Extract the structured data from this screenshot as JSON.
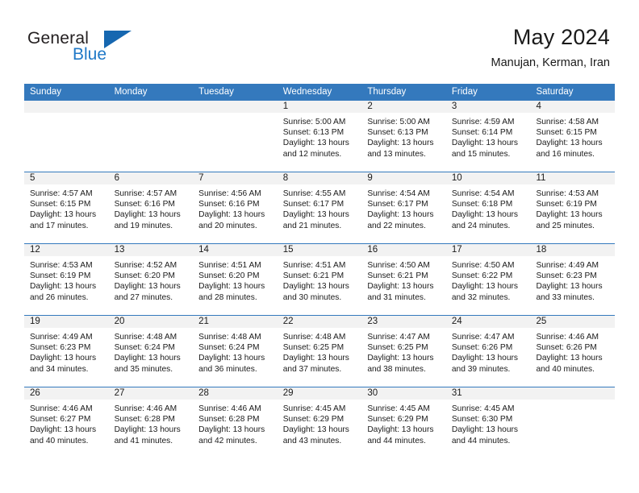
{
  "brand": {
    "word_one": "General",
    "word_two": "Blue",
    "logo_icon": "triangle-logo-icon",
    "accent_color": "#1667b0"
  },
  "header": {
    "title": "May 2024",
    "location": "Manujan, Kerman, Iran"
  },
  "theme": {
    "header_blue": "#3479bd",
    "day_band_gray": "#f2f2f2",
    "text_color": "#1a1a1a"
  },
  "weekday_headers": [
    "Sunday",
    "Monday",
    "Tuesday",
    "Wednesday",
    "Thursday",
    "Friday",
    "Saturday"
  ],
  "weeks": [
    {
      "days": [
        {
          "date": "",
          "empty": true,
          "sunrise": "",
          "sunset": "",
          "daylight_line1": "",
          "daylight_line2": ""
        },
        {
          "date": "",
          "empty": true,
          "sunrise": "",
          "sunset": "",
          "daylight_line1": "",
          "daylight_line2": ""
        },
        {
          "date": "",
          "empty": true,
          "sunrise": "",
          "sunset": "",
          "daylight_line1": "",
          "daylight_line2": ""
        },
        {
          "date": "1",
          "empty": false,
          "sunrise": "Sunrise: 5:00 AM",
          "sunset": "Sunset: 6:13 PM",
          "daylight_line1": "Daylight: 13 hours",
          "daylight_line2": "and 12 minutes."
        },
        {
          "date": "2",
          "empty": false,
          "sunrise": "Sunrise: 5:00 AM",
          "sunset": "Sunset: 6:13 PM",
          "daylight_line1": "Daylight: 13 hours",
          "daylight_line2": "and 13 minutes."
        },
        {
          "date": "3",
          "empty": false,
          "sunrise": "Sunrise: 4:59 AM",
          "sunset": "Sunset: 6:14 PM",
          "daylight_line1": "Daylight: 13 hours",
          "daylight_line2": "and 15 minutes."
        },
        {
          "date": "4",
          "empty": false,
          "sunrise": "Sunrise: 4:58 AM",
          "sunset": "Sunset: 6:15 PM",
          "daylight_line1": "Daylight: 13 hours",
          "daylight_line2": "and 16 minutes."
        }
      ]
    },
    {
      "days": [
        {
          "date": "5",
          "empty": false,
          "sunrise": "Sunrise: 4:57 AM",
          "sunset": "Sunset: 6:15 PM",
          "daylight_line1": "Daylight: 13 hours",
          "daylight_line2": "and 17 minutes."
        },
        {
          "date": "6",
          "empty": false,
          "sunrise": "Sunrise: 4:57 AM",
          "sunset": "Sunset: 6:16 PM",
          "daylight_line1": "Daylight: 13 hours",
          "daylight_line2": "and 19 minutes."
        },
        {
          "date": "7",
          "empty": false,
          "sunrise": "Sunrise: 4:56 AM",
          "sunset": "Sunset: 6:16 PM",
          "daylight_line1": "Daylight: 13 hours",
          "daylight_line2": "and 20 minutes."
        },
        {
          "date": "8",
          "empty": false,
          "sunrise": "Sunrise: 4:55 AM",
          "sunset": "Sunset: 6:17 PM",
          "daylight_line1": "Daylight: 13 hours",
          "daylight_line2": "and 21 minutes."
        },
        {
          "date": "9",
          "empty": false,
          "sunrise": "Sunrise: 4:54 AM",
          "sunset": "Sunset: 6:17 PM",
          "daylight_line1": "Daylight: 13 hours",
          "daylight_line2": "and 22 minutes."
        },
        {
          "date": "10",
          "empty": false,
          "sunrise": "Sunrise: 4:54 AM",
          "sunset": "Sunset: 6:18 PM",
          "daylight_line1": "Daylight: 13 hours",
          "daylight_line2": "and 24 minutes."
        },
        {
          "date": "11",
          "empty": false,
          "sunrise": "Sunrise: 4:53 AM",
          "sunset": "Sunset: 6:19 PM",
          "daylight_line1": "Daylight: 13 hours",
          "daylight_line2": "and 25 minutes."
        }
      ]
    },
    {
      "days": [
        {
          "date": "12",
          "empty": false,
          "sunrise": "Sunrise: 4:53 AM",
          "sunset": "Sunset: 6:19 PM",
          "daylight_line1": "Daylight: 13 hours",
          "daylight_line2": "and 26 minutes."
        },
        {
          "date": "13",
          "empty": false,
          "sunrise": "Sunrise: 4:52 AM",
          "sunset": "Sunset: 6:20 PM",
          "daylight_line1": "Daylight: 13 hours",
          "daylight_line2": "and 27 minutes."
        },
        {
          "date": "14",
          "empty": false,
          "sunrise": "Sunrise: 4:51 AM",
          "sunset": "Sunset: 6:20 PM",
          "daylight_line1": "Daylight: 13 hours",
          "daylight_line2": "and 28 minutes."
        },
        {
          "date": "15",
          "empty": false,
          "sunrise": "Sunrise: 4:51 AM",
          "sunset": "Sunset: 6:21 PM",
          "daylight_line1": "Daylight: 13 hours",
          "daylight_line2": "and 30 minutes."
        },
        {
          "date": "16",
          "empty": false,
          "sunrise": "Sunrise: 4:50 AM",
          "sunset": "Sunset: 6:21 PM",
          "daylight_line1": "Daylight: 13 hours",
          "daylight_line2": "and 31 minutes."
        },
        {
          "date": "17",
          "empty": false,
          "sunrise": "Sunrise: 4:50 AM",
          "sunset": "Sunset: 6:22 PM",
          "daylight_line1": "Daylight: 13 hours",
          "daylight_line2": "and 32 minutes."
        },
        {
          "date": "18",
          "empty": false,
          "sunrise": "Sunrise: 4:49 AM",
          "sunset": "Sunset: 6:23 PM",
          "daylight_line1": "Daylight: 13 hours",
          "daylight_line2": "and 33 minutes."
        }
      ]
    },
    {
      "days": [
        {
          "date": "19",
          "empty": false,
          "sunrise": "Sunrise: 4:49 AM",
          "sunset": "Sunset: 6:23 PM",
          "daylight_line1": "Daylight: 13 hours",
          "daylight_line2": "and 34 minutes."
        },
        {
          "date": "20",
          "empty": false,
          "sunrise": "Sunrise: 4:48 AM",
          "sunset": "Sunset: 6:24 PM",
          "daylight_line1": "Daylight: 13 hours",
          "daylight_line2": "and 35 minutes."
        },
        {
          "date": "21",
          "empty": false,
          "sunrise": "Sunrise: 4:48 AM",
          "sunset": "Sunset: 6:24 PM",
          "daylight_line1": "Daylight: 13 hours",
          "daylight_line2": "and 36 minutes."
        },
        {
          "date": "22",
          "empty": false,
          "sunrise": "Sunrise: 4:48 AM",
          "sunset": "Sunset: 6:25 PM",
          "daylight_line1": "Daylight: 13 hours",
          "daylight_line2": "and 37 minutes."
        },
        {
          "date": "23",
          "empty": false,
          "sunrise": "Sunrise: 4:47 AM",
          "sunset": "Sunset: 6:25 PM",
          "daylight_line1": "Daylight: 13 hours",
          "daylight_line2": "and 38 minutes."
        },
        {
          "date": "24",
          "empty": false,
          "sunrise": "Sunrise: 4:47 AM",
          "sunset": "Sunset: 6:26 PM",
          "daylight_line1": "Daylight: 13 hours",
          "daylight_line2": "and 39 minutes."
        },
        {
          "date": "25",
          "empty": false,
          "sunrise": "Sunrise: 4:46 AM",
          "sunset": "Sunset: 6:26 PM",
          "daylight_line1": "Daylight: 13 hours",
          "daylight_line2": "and 40 minutes."
        }
      ]
    },
    {
      "days": [
        {
          "date": "26",
          "empty": false,
          "sunrise": "Sunrise: 4:46 AM",
          "sunset": "Sunset: 6:27 PM",
          "daylight_line1": "Daylight: 13 hours",
          "daylight_line2": "and 40 minutes."
        },
        {
          "date": "27",
          "empty": false,
          "sunrise": "Sunrise: 4:46 AM",
          "sunset": "Sunset: 6:28 PM",
          "daylight_line1": "Daylight: 13 hours",
          "daylight_line2": "and 41 minutes."
        },
        {
          "date": "28",
          "empty": false,
          "sunrise": "Sunrise: 4:46 AM",
          "sunset": "Sunset: 6:28 PM",
          "daylight_line1": "Daylight: 13 hours",
          "daylight_line2": "and 42 minutes."
        },
        {
          "date": "29",
          "empty": false,
          "sunrise": "Sunrise: 4:45 AM",
          "sunset": "Sunset: 6:29 PM",
          "daylight_line1": "Daylight: 13 hours",
          "daylight_line2": "and 43 minutes."
        },
        {
          "date": "30",
          "empty": false,
          "sunrise": "Sunrise: 4:45 AM",
          "sunset": "Sunset: 6:29 PM",
          "daylight_line1": "Daylight: 13 hours",
          "daylight_line2": "and 44 minutes."
        },
        {
          "date": "31",
          "empty": false,
          "sunrise": "Sunrise: 4:45 AM",
          "sunset": "Sunset: 6:30 PM",
          "daylight_line1": "Daylight: 13 hours",
          "daylight_line2": "and 44 minutes."
        },
        {
          "date": "",
          "empty": true,
          "sunrise": "",
          "sunset": "",
          "daylight_line1": "",
          "daylight_line2": ""
        }
      ]
    }
  ]
}
